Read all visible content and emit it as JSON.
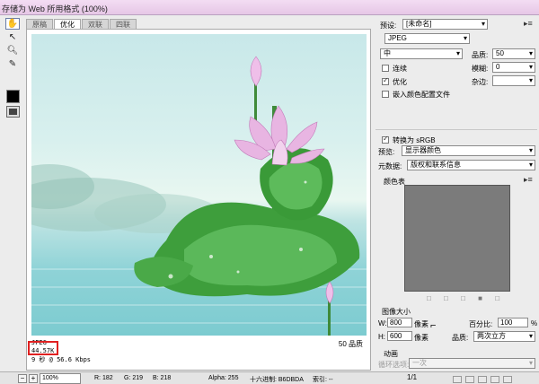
{
  "window": {
    "title": "存储为 Web 所用格式 (100%)"
  },
  "tabs": [
    "原稿",
    "优化",
    "双联",
    "四联"
  ],
  "image_info": {
    "format": "JPEG",
    "size": "44.57K",
    "time": "9 秒 @ 56.6 Kbps",
    "quality": "50 品质"
  },
  "status": {
    "zoom": "100%",
    "r": "R: 182",
    "g": "G: 219",
    "b": "B: 218",
    "alpha": "Alpha: 255",
    "hex": "十六进制: B6DBDA",
    "index": "索引: --"
  },
  "settings": {
    "preset_label": "预设:",
    "preset_value": "[未命名]",
    "format_value": "JPEG",
    "quality_level": "中",
    "quality_label": "品质:",
    "quality_value": "50",
    "progressive": "连续",
    "blur_label": "模糊:",
    "blur_value": "0",
    "optimized": "优化",
    "matte_label": "杂边:",
    "embed_profile": "嵌入颜色配置文件",
    "convert_srgb": "转换为 sRGB",
    "preview_label": "预览:",
    "preview_value": "显示器颜色",
    "metadata_label": "元数据:",
    "metadata_value": "版权和联系信息"
  },
  "color_table": {
    "title": "颜色表"
  },
  "image_size": {
    "title": "图像大小",
    "width_label": "W:",
    "width_value": "800",
    "width_unit": "像素",
    "height_label": "H:",
    "height_value": "600",
    "height_unit": "像素",
    "percent_label": "百分比:",
    "percent_value": "100",
    "percent_unit": "%",
    "quality_label": "品质:",
    "quality_value": "两次立方"
  },
  "animation": {
    "title": "动画",
    "loop_label": "循环选项:",
    "loop_value": "一次",
    "frame": "1/1"
  }
}
